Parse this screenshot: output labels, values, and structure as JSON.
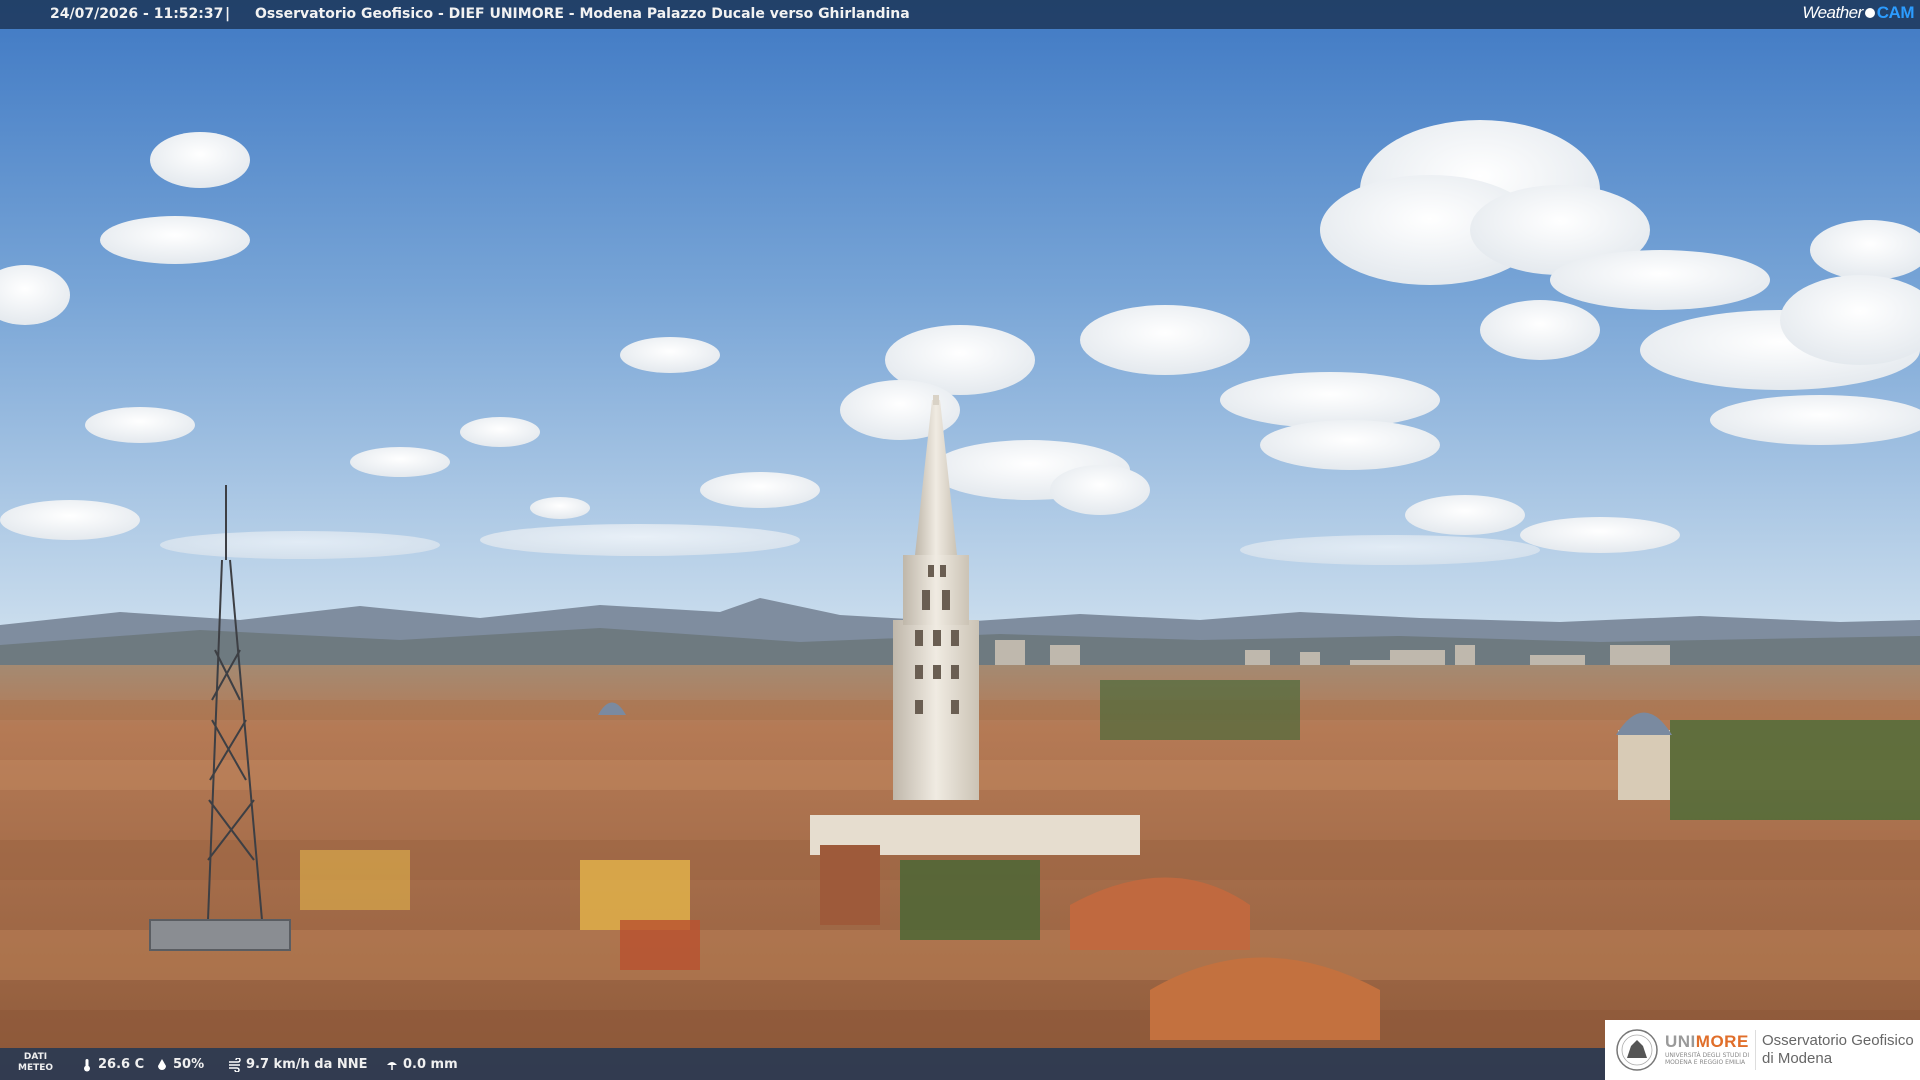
{
  "header": {
    "timestamp": "24/07/2026 - 11:52:37",
    "separator": "|",
    "title": "Osservatorio Geofisico - DIEF UNIMORE - Modena Palazzo Ducale verso Ghirlandina",
    "logo_weather": "Weather",
    "logo_cam": "CAM"
  },
  "weather_bar": {
    "label_line1": "DATI",
    "label_line2": "METEO",
    "temperature": "26.6 C",
    "humidity": "50%",
    "wind": "9.7 km/h da NNE",
    "rain": "0.0 mm",
    "icons": [
      "thermometer-icon",
      "humidity-drop-icon",
      "wind-icon",
      "rain-gauge-icon"
    ]
  },
  "branding": {
    "uni": "UNI",
    "more": "MORE",
    "uni_subtitle": "UNIVERSITÀ DEGLI STUDI DI MODENA E REGGIO EMILIA",
    "observatory_line1": "Osservatorio Geofisico",
    "observatory_line2": "di Modena"
  },
  "colors": {
    "sky_top": "#5b8fcf",
    "sky_bottom": "#cfe0ef",
    "roofs": "#b7784e",
    "tower": "#e8e2d6",
    "bar": "#1c3456",
    "unimore_orange": "#e06e2a",
    "weathercam_blue": "#2c9cff"
  }
}
